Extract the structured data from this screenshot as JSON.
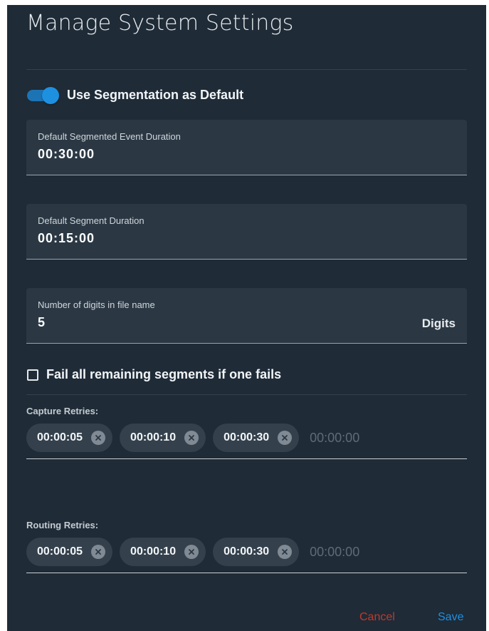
{
  "dialog": {
    "title": "Manage System Settings"
  },
  "segmentation_toggle": {
    "label": "Use Segmentation as Default",
    "checked": true,
    "color": "#1e90e0"
  },
  "fields": {
    "event_duration": {
      "label": "Default Segmented Event Duration",
      "value": "00:30:00"
    },
    "segment_duration": {
      "label": "Default Segment Duration",
      "value": "00:15:00"
    },
    "digits": {
      "label": "Number of digits in file name",
      "value": "5",
      "suffix": "Digits"
    }
  },
  "fail_checkbox": {
    "label": "Fail all remaining segments if one fails",
    "checked": false
  },
  "capture_retries": {
    "label": "Capture Retries:",
    "chips": [
      "00:00:05",
      "00:00:10",
      "00:00:30"
    ],
    "placeholder": "00:00:00"
  },
  "routing_retries": {
    "label": "Routing Retries:",
    "chips": [
      "00:00:05",
      "00:00:10",
      "00:00:30"
    ],
    "placeholder": "00:00:00"
  },
  "footer": {
    "cancel_label": "Cancel",
    "save_label": "Save",
    "cancel_color": "#c0392b",
    "save_color": "#1e90e0"
  }
}
